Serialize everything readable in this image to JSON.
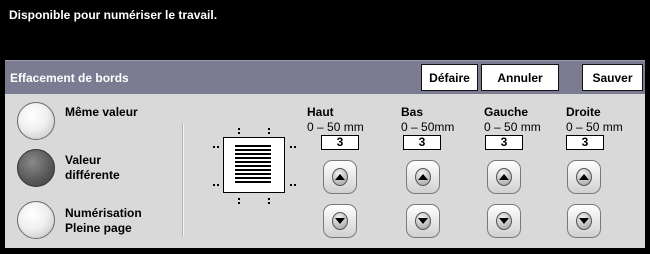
{
  "status": {
    "message": "Disponible pour numériser le travail."
  },
  "header": {
    "title": "Effacement de bords",
    "undo_label": "Défaire",
    "cancel_label": "Annuler",
    "save_label": "Sauver"
  },
  "options": [
    {
      "label": "Même valeur",
      "selected": false
    },
    {
      "label": "Valeur différente",
      "selected": true
    },
    {
      "label": "Numérisation Pleine page",
      "selected": false
    }
  ],
  "edges": [
    {
      "name": "Haut",
      "range": "0 – 50 mm",
      "value": "3"
    },
    {
      "name": "Bas",
      "range": "0 – 50mm",
      "value": "3"
    },
    {
      "name": "Gauche",
      "range": "0 – 50 mm",
      "value": "3"
    },
    {
      "name": "Droite",
      "range": "0 – 50 mm",
      "value": "3"
    }
  ],
  "icons": {
    "increase": "arrow-up-icon",
    "decrease": "arrow-down-icon",
    "document": "document-preview-icon"
  }
}
